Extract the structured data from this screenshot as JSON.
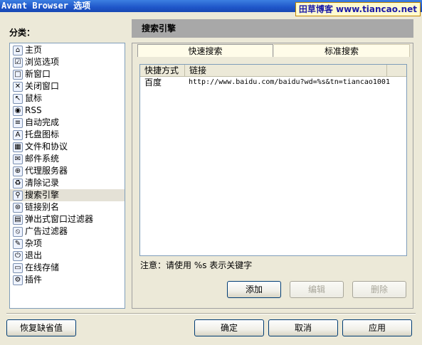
{
  "window": {
    "title": "Avant Browser 选项"
  },
  "watermark": "田草博客 www.tiancao.net",
  "sidebar": {
    "label": "分类：",
    "items": [
      {
        "label": "主页",
        "icon": "home-icon",
        "glyph": "⌂"
      },
      {
        "label": "浏览选项",
        "icon": "browse-options-icon",
        "glyph": "☑"
      },
      {
        "label": "新窗口",
        "icon": "new-window-icon",
        "glyph": "□"
      },
      {
        "label": "关闭窗口",
        "icon": "close-window-icon",
        "glyph": "✕"
      },
      {
        "label": "鼠标",
        "icon": "mouse-icon",
        "glyph": "↖"
      },
      {
        "label": "RSS",
        "icon": "rss-icon",
        "glyph": "◉"
      },
      {
        "label": "自动完成",
        "icon": "autocomplete-icon",
        "glyph": "≡"
      },
      {
        "label": "托盘图标",
        "icon": "tray-icon",
        "glyph": "A"
      },
      {
        "label": "文件和协议",
        "icon": "file-protocol-icon",
        "glyph": "▦"
      },
      {
        "label": "邮件系统",
        "icon": "mail-icon",
        "glyph": "✉"
      },
      {
        "label": "代理服务器",
        "icon": "proxy-icon",
        "glyph": "⊕"
      },
      {
        "label": "清除记录",
        "icon": "trash-icon",
        "glyph": "♻"
      },
      {
        "label": "搜索引擎",
        "icon": "search-engine-icon",
        "glyph": "⚲"
      },
      {
        "label": "链接别名",
        "icon": "link-alias-icon",
        "glyph": "⊛"
      },
      {
        "label": "弹出式窗口过滤器",
        "icon": "popup-filter-icon",
        "glyph": "▤"
      },
      {
        "label": "广告过滤器",
        "icon": "ad-filter-icon",
        "glyph": "⦸"
      },
      {
        "label": "杂项",
        "icon": "misc-icon",
        "glyph": "✎"
      },
      {
        "label": "退出",
        "icon": "exit-icon",
        "glyph": "⏻"
      },
      {
        "label": "在线存储",
        "icon": "online-storage-icon",
        "glyph": "▭"
      },
      {
        "label": "插件",
        "icon": "plugin-icon",
        "glyph": "⚙"
      }
    ],
    "selected_index": 12
  },
  "main": {
    "title": "搜索引擎",
    "tabs": [
      {
        "label": "快速搜索"
      },
      {
        "label": "标准搜索"
      }
    ],
    "table": {
      "columns": [
        "快捷方式",
        "链接"
      ],
      "rows": [
        [
          "百度",
          "http://www.baidu.com/baidu?wd=%s&tn=tiancao1001"
        ]
      ]
    },
    "note": "注意：请使用 %s 表示关键字",
    "add_label": "添加",
    "edit_label": "编辑",
    "delete_label": "删除"
  },
  "footer": {
    "restore_label": "恢复缺省值",
    "ok_label": "确定",
    "cancel_label": "取消",
    "apply_label": "应用"
  }
}
